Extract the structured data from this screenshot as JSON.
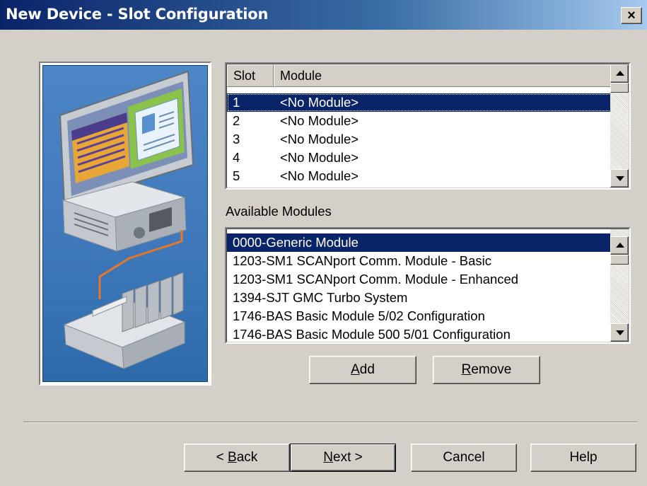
{
  "window": {
    "title": "New Device - Slot Configuration",
    "close_glyph": "×"
  },
  "slots": {
    "headers": [
      "Slot",
      "Module"
    ],
    "rows": [
      {
        "slot": "1",
        "module": "<No Module>"
      },
      {
        "slot": "2",
        "module": "<No Module>"
      },
      {
        "slot": "3",
        "module": "<No Module>"
      },
      {
        "slot": "4",
        "module": "<No Module>"
      },
      {
        "slot": "5",
        "module": "<No Module>"
      }
    ],
    "selected_index": 0
  },
  "available": {
    "label": "Available Modules",
    "items": [
      "0000-Generic Module",
      "1203-SM1 SCANport Comm. Module - Basic",
      "1203-SM1 SCANport Comm. Module - Enhanced",
      "1394-SJT GMC Turbo System",
      "1746-BAS Basic Module 5/02 Configuration",
      "1746-BAS Basic Module 500 5/01 Configuration"
    ],
    "selected_index": 0
  },
  "buttons": {
    "add": {
      "pre": "",
      "key": "A",
      "post": "dd"
    },
    "remove": {
      "pre": "",
      "key": "R",
      "post": "emove"
    },
    "back": {
      "pre": "< ",
      "key": "B",
      "post": "ack"
    },
    "next": {
      "pre": "",
      "key": "N",
      "post": "ext >"
    },
    "cancel": "Cancel",
    "help": "Help"
  },
  "icons": {
    "wizard_art": "computer-plc-illustration",
    "scroll_up": "triangle-up-icon",
    "scroll_down": "triangle-down-icon"
  }
}
